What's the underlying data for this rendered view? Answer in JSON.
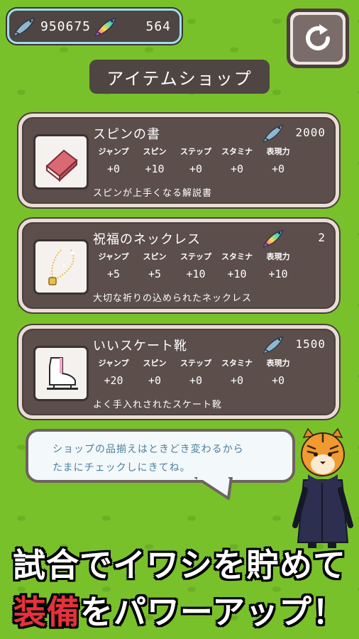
{
  "header": {
    "sardine_count": "950675",
    "rainbow_count": "564",
    "sardine_icon": "sardine-icon",
    "rainbow_icon": "rainbow-sardine-icon",
    "refresh_icon": "refresh-icon"
  },
  "shop": {
    "title": "アイテムショップ",
    "stat_labels": [
      "ジャンプ",
      "スピン",
      "ステップ",
      "スタミナ",
      "表現力"
    ],
    "items": [
      {
        "name": "スピンの書",
        "price": "2000",
        "currency": "sardine",
        "stats": [
          "+0",
          "+10",
          "+0",
          "+0",
          "+0"
        ],
        "description": "スピンが上手くなる解説書",
        "icon": "book-icon"
      },
      {
        "name": "祝福のネックレス",
        "price": "2",
        "currency": "rainbow-sardine",
        "stats": [
          "+5",
          "+5",
          "+10",
          "+10",
          "+10"
        ],
        "description": "大切な祈りの込められたネックレス",
        "icon": "necklace-icon"
      },
      {
        "name": "いいスケート靴",
        "price": "1500",
        "currency": "sardine",
        "stats": [
          "+20",
          "+0",
          "+0",
          "+0",
          "+0"
        ],
        "description": "よく手入れされたスケート靴",
        "icon": "skate-icon"
      }
    ]
  },
  "speech": {
    "line1": "ショップの品揃えはときどき変わるから",
    "line2": "たまにチェックしにきてね。"
  },
  "promo": {
    "line1": "試合でイワシを貯めて",
    "line2_highlight": "装備",
    "line2_rest": "をパワーアップ！"
  },
  "colors": {
    "background": "#79c12b",
    "panel": "#5b4e4b",
    "panel_border": "#e9ddd6",
    "speech_text": "#4b7f9c",
    "promo_highlight": "#e5323c"
  }
}
